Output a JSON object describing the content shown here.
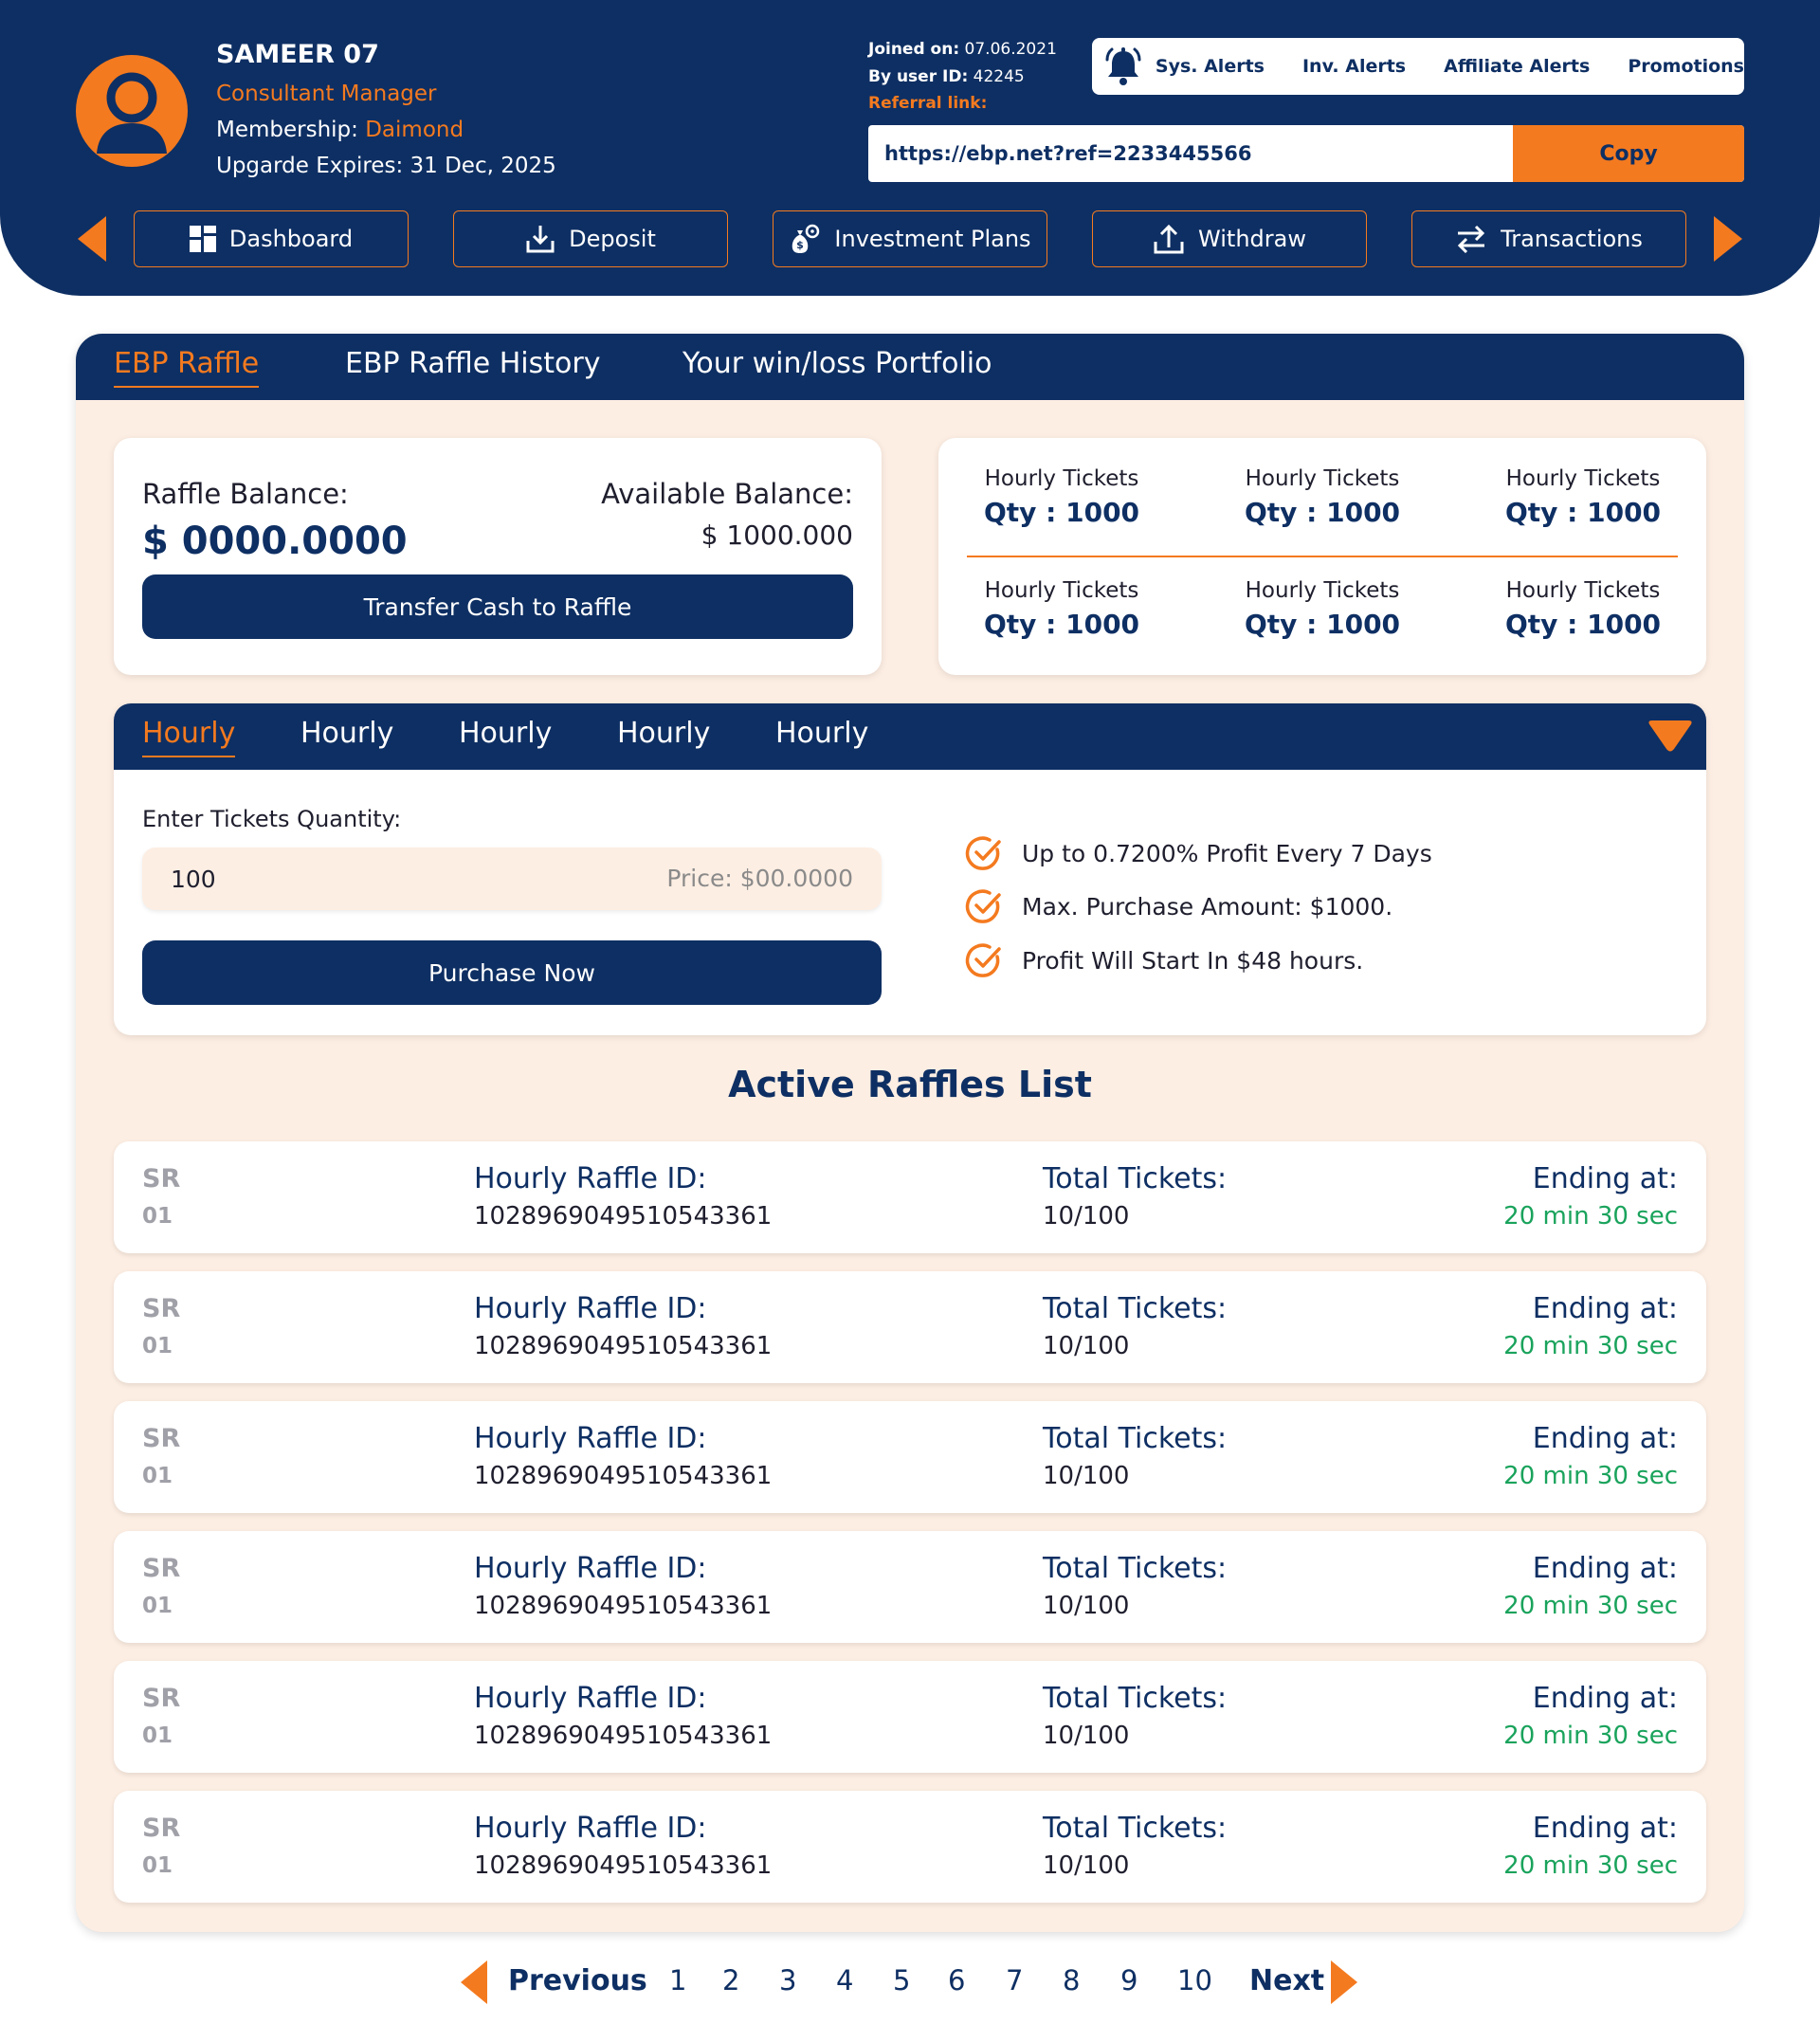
{
  "user": {
    "name": "SAMEER 07",
    "role": "Consultant Manager",
    "membership_label": "Membership: ",
    "membership_value": "Daimond",
    "expires": "Upgarde Expires: 31 Dec, 2025"
  },
  "account": {
    "joined_label": "Joined on:",
    "joined_value": "07.06.2021",
    "userid_label": "By user ID:",
    "userid_value": "42245",
    "referral_label": "Referral link:",
    "referral_url": "https://ebp.net?ref=2233445566",
    "copy_label": "Copy"
  },
  "alerts": [
    "Sys. Alerts",
    "Inv. Alerts",
    "Affiliate Alerts",
    "Promotions"
  ],
  "nav": [
    {
      "label": "Dashboard",
      "icon": "grid-icon"
    },
    {
      "label": "Deposit",
      "icon": "download-icon"
    },
    {
      "label": "Investment Plans",
      "icon": "money-bag-icon"
    },
    {
      "label": "Withdraw",
      "icon": "upload-icon"
    },
    {
      "label": "Transactions",
      "icon": "swap-arrows-icon"
    }
  ],
  "main_tabs": [
    "EBP Raffle",
    "EBP Raffle History",
    "Your win/loss Portfolio"
  ],
  "balance": {
    "raffle_label": "Raffle Balance:",
    "raffle_value": "$ 0000.0000",
    "available_label": "Available Balance:",
    "available_value": "$ 1000.000",
    "transfer_label": "Transfer Cash to Raffle"
  },
  "tickets": [
    {
      "label": "Hourly Tickets",
      "qty": "Qty : 1000"
    },
    {
      "label": "Hourly Tickets",
      "qty": "Qty : 1000"
    },
    {
      "label": "Hourly Tickets",
      "qty": "Qty : 1000"
    },
    {
      "label": "Hourly Tickets",
      "qty": "Qty : 1000"
    },
    {
      "label": "Hourly Tickets",
      "qty": "Qty : 1000"
    },
    {
      "label": "Hourly Tickets",
      "qty": "Qty : 1000"
    }
  ],
  "purchase": {
    "tabs": [
      "Hourly",
      "Hourly",
      "Hourly",
      "Hourly",
      "Hourly"
    ],
    "qty_label": "Enter Tickets Quantity:",
    "qty_value": "100",
    "price": "Price: $00.0000",
    "button_label": "Purchase Now",
    "features": [
      "Up to 0.7200% Profit Every 7 Days",
      "Max. Purchase Amount: $1000.",
      "Profit Will Start In $48 hours."
    ]
  },
  "list": {
    "title": "Active Raffles List",
    "rows": [
      {
        "sr": "SR",
        "num": "01",
        "id_label": "Hourly Raffle ID:",
        "id": "1028969049510543361",
        "tickets_label": "Total Tickets:",
        "tickets": "10/100",
        "ending_label": "Ending at:",
        "ending": "20 min 30 sec"
      },
      {
        "sr": "SR",
        "num": "01",
        "id_label": "Hourly Raffle ID:",
        "id": "1028969049510543361",
        "tickets_label": "Total Tickets:",
        "tickets": "10/100",
        "ending_label": "Ending at:",
        "ending": "20 min 30 sec"
      },
      {
        "sr": "SR",
        "num": "01",
        "id_label": "Hourly Raffle ID:",
        "id": "1028969049510543361",
        "tickets_label": "Total Tickets:",
        "tickets": "10/100",
        "ending_label": "Ending at:",
        "ending": "20 min 30 sec"
      },
      {
        "sr": "SR",
        "num": "01",
        "id_label": "Hourly Raffle ID:",
        "id": "1028969049510543361",
        "tickets_label": "Total Tickets:",
        "tickets": "10/100",
        "ending_label": "Ending at:",
        "ending": "20 min 30 sec"
      },
      {
        "sr": "SR",
        "num": "01",
        "id_label": "Hourly Raffle ID:",
        "id": "1028969049510543361",
        "tickets_label": "Total Tickets:",
        "tickets": "10/100",
        "ending_label": "Ending at:",
        "ending": "20 min 30 sec"
      },
      {
        "sr": "SR",
        "num": "01",
        "id_label": "Hourly Raffle ID:",
        "id": "1028969049510543361",
        "tickets_label": "Total Tickets:",
        "tickets": "10/100",
        "ending_label": "Ending at:",
        "ending": "20 min 30 sec"
      }
    ]
  },
  "pagination": {
    "previous": "Previous",
    "next": "Next",
    "pages": [
      "1",
      "2",
      "3",
      "4",
      "5",
      "6",
      "7",
      "8",
      "9",
      "10"
    ]
  },
  "colors": {
    "navy": "#0e2f63",
    "orange": "#f47a1f",
    "cream": "#fdeee3",
    "green": "#1aa35c"
  }
}
